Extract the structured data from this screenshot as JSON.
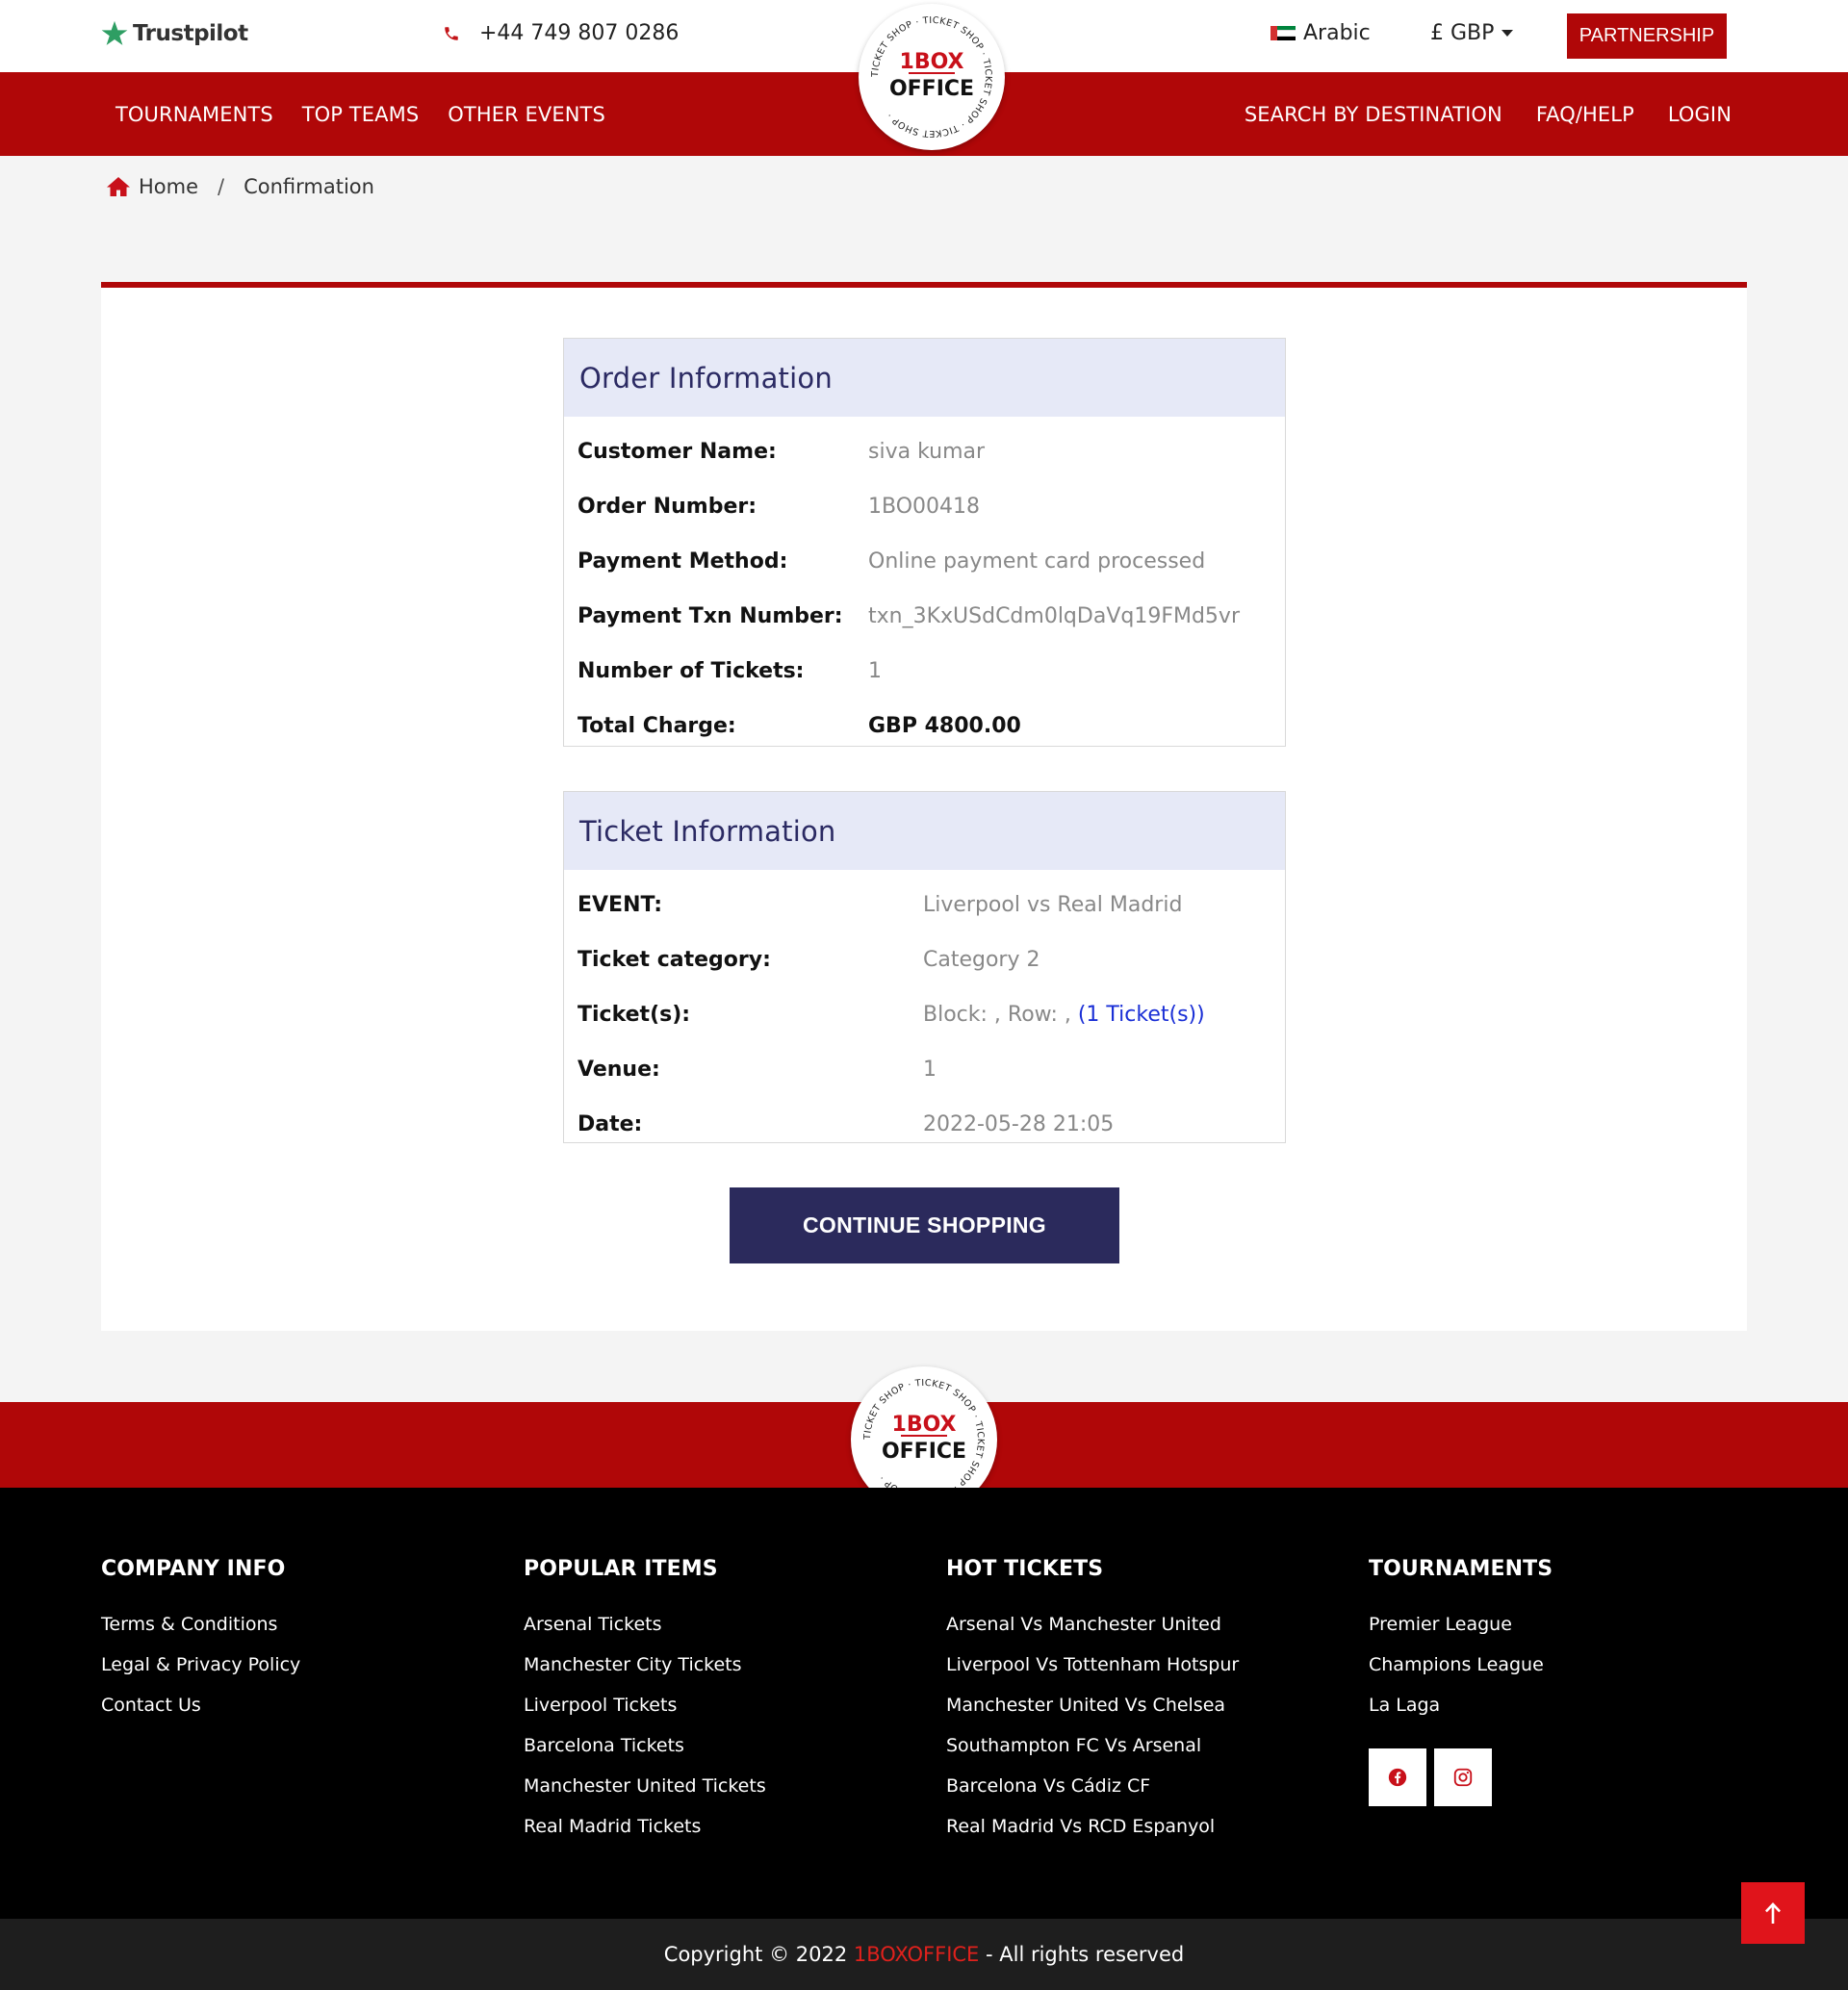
{
  "topbar": {
    "trustpilot_label": "Trustpilot",
    "phone": "+44 749 807 0286",
    "language": "Arabic",
    "currency": "£ GBP",
    "partnership_label": "PARTNERSHIP"
  },
  "nav": {
    "left": [
      "TOURNAMENTS",
      "TOP TEAMS",
      "OTHER EVENTS"
    ],
    "right": [
      "SEARCH BY DESTINATION",
      "FAQ/HELP",
      "LOGIN"
    ]
  },
  "logo": {
    "line1": "1BOX",
    "line2": "OFFICE",
    "ring_text": "TICKET SHOP · TICKET SHOP · TICKET SHOP · TICKET SHOP ·"
  },
  "breadcrumb": {
    "home": "Home",
    "separator": "/",
    "current": "Confirmation"
  },
  "order": {
    "title": "Order Information",
    "rows": [
      {
        "label": "Customer Name:",
        "value": "siva kumar"
      },
      {
        "label": "Order Number:",
        "value": "1BO00418"
      },
      {
        "label": "Payment Method:",
        "value": "Online payment card processed"
      },
      {
        "label": "Payment Txn Number:",
        "value": "txn_3KxUSdCdm0lqDaVq19FMd5vr"
      },
      {
        "label": "Number of Tickets:",
        "value": "1"
      },
      {
        "label": "Total Charge:",
        "value": "GBP 4800.00"
      }
    ]
  },
  "ticket": {
    "title": "Ticket Information",
    "event_label": "EVENT:",
    "event_value": "Liverpool vs Real Madrid",
    "category_label": "Ticket category:",
    "category_value": "Category 2",
    "tickets_label": "Ticket(s):",
    "tickets_value": "Block: , Row: ,",
    "tickets_link": "(1 Ticket(s))",
    "venue_label": "Venue:",
    "venue_value": "1",
    "date_label": "Date:",
    "date_value": "2022-05-28 21:05"
  },
  "continue_label": "CONTINUE SHOPPING",
  "footer": {
    "company": {
      "title": "COMPANY INFO",
      "items": [
        "Terms & Conditions",
        "Legal & Privacy Policy",
        "Contact Us"
      ]
    },
    "popular": {
      "title": "POPULAR ITEMS",
      "items": [
        "Arsenal Tickets",
        "Manchester City Tickets",
        "Liverpool Tickets",
        "Barcelona Tickets",
        "Manchester United Tickets",
        "Real Madrid Tickets"
      ]
    },
    "hot": {
      "title": "HOT TICKETS",
      "items": [
        "Arsenal Vs Manchester United",
        "Liverpool Vs Tottenham Hotspur",
        "Manchester United Vs Chelsea",
        "Southampton FC Vs Arsenal",
        "Barcelona Vs Cádiz CF",
        "Real Madrid Vs RCD Espanyol"
      ]
    },
    "tournaments": {
      "title": "TOURNAMENTS",
      "items": [
        "Premier League",
        "Champions League",
        "La Laga"
      ]
    }
  },
  "copyright": {
    "prefix": "Copyright © 2022 ",
    "brand": "1BOXOFFICE",
    "suffix": " - All rights reserved"
  },
  "colors": {
    "brand_red": "#b00708",
    "navy": "#2b2a5c",
    "header_bg": "#e6e9f7",
    "link_blue": "#1a2fd6"
  },
  "icons": [
    "trustpilot-star-icon",
    "phone-icon",
    "uae-flag-icon",
    "caret-down-icon",
    "home-icon",
    "facebook-icon",
    "instagram-icon",
    "arrow-up-icon"
  ]
}
